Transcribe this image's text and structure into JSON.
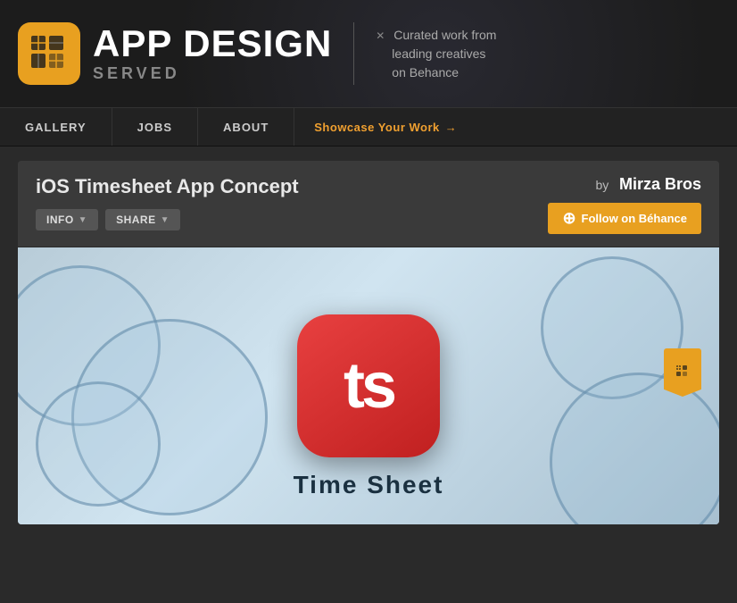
{
  "header": {
    "logo_title": "APP DESIGN",
    "logo_subtitle": "SERVED",
    "tagline_line1": "Curated work from",
    "tagline_line2": "leading creatives",
    "tagline_line3": "on Behance"
  },
  "nav": {
    "gallery_label": "GALLERY",
    "jobs_label": "JOBS",
    "about_label": "ABOUT",
    "showcase_label": "Showcase Your Work",
    "showcase_arrow": "→"
  },
  "project": {
    "title": "iOS Timesheet App Concept",
    "by_label": "by",
    "author_name": "Mirza Bros",
    "info_label": "INFO",
    "share_label": "SHARE",
    "follow_label": "Follow on Béhance",
    "timesheet_label": "Time Sheet"
  }
}
